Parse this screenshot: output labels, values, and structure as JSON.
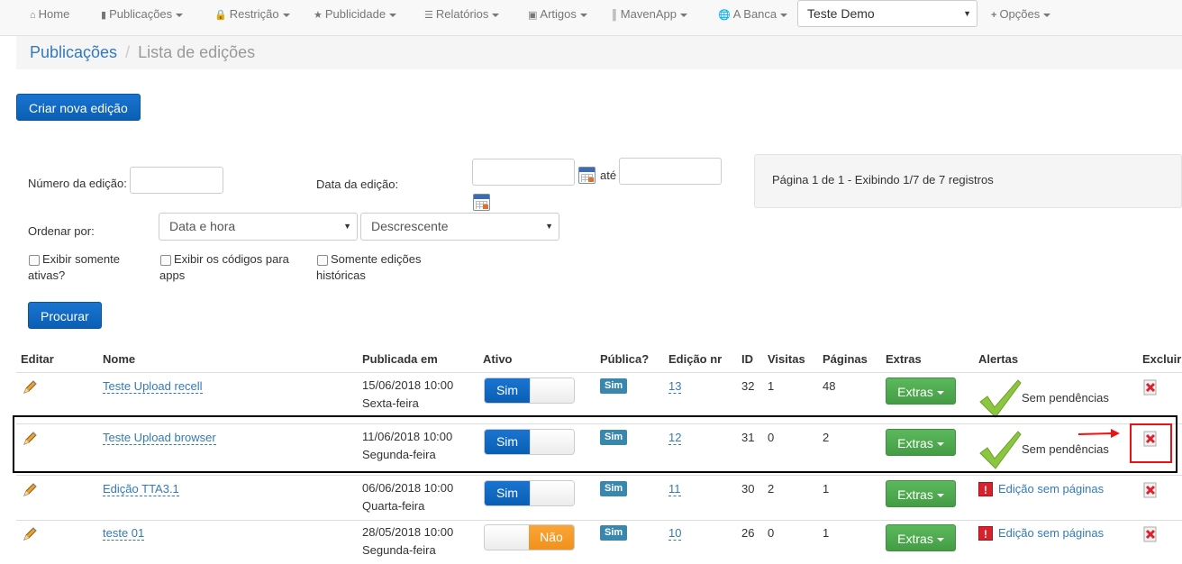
{
  "navbar": {
    "items": [
      {
        "label": "Home",
        "icon": "home-icon",
        "dropdown": false
      },
      {
        "label": "Publicações",
        "icon": "file-icon",
        "dropdown": true
      },
      {
        "label": "Restrição",
        "icon": "lock-icon",
        "dropdown": true
      },
      {
        "label": "Publicidade",
        "icon": "star-icon",
        "dropdown": true
      },
      {
        "label": "Relatórios",
        "icon": "list-icon",
        "dropdown": true
      },
      {
        "label": "Artigos",
        "icon": "book-icon",
        "dropdown": true
      },
      {
        "label": "MavenApp",
        "icon": "barcode-icon",
        "dropdown": true
      },
      {
        "label": "A Banca",
        "icon": "globe-icon",
        "dropdown": true
      }
    ],
    "account_select": "Teste Demo",
    "options": {
      "label": "Opções",
      "icon": "plus-icon"
    }
  },
  "breadcrumb": {
    "parent": "Publicações",
    "separator": "/",
    "current": "Lista de edições"
  },
  "create_button": "Criar nova edição",
  "filters": {
    "edition_number_label": "Número da edição:",
    "edition_date_label": "Data da edição:",
    "until_label": "até",
    "order_by_label": "Ordenar por:",
    "order_field": "Data e hora",
    "order_direction": "Descrescente",
    "checkboxes": [
      {
        "line1": "Exibir somente",
        "line2": "ativas?",
        "checked": false
      },
      {
        "line1": "Exibir os códigos para",
        "line2": "apps",
        "checked": false
      },
      {
        "line1": "Somente edições",
        "line2": "históricas",
        "checked": false
      }
    ],
    "search_button": "Procurar"
  },
  "pagination_info": "Página 1 de 1 - Exibindo 1/7 de 7 registros",
  "table": {
    "headers": [
      "Editar",
      "Nome",
      "Publicada em",
      "Ativo",
      "Pública?",
      "Edição nr",
      "ID",
      "Visitas",
      "Páginas",
      "Extras",
      "Alertas",
      "Excluir"
    ],
    "rows": [
      {
        "name": "Teste Upload recell",
        "date": "15/06/2018 10:00",
        "weekday": "Sexta-feira",
        "active": "Sim",
        "public": "Sim",
        "edition": "13",
        "id": "32",
        "visits": "1",
        "pages": "48",
        "extras": "Extras",
        "alert": "Sem pendências",
        "alert_type": "ok"
      },
      {
        "name": "Teste Upload browser",
        "date": "11/06/2018 10:00",
        "weekday": "Segunda-feira",
        "active": "Sim",
        "public": "Sim",
        "edition": "12",
        "id": "31",
        "visits": "0",
        "pages": "2",
        "extras": "Extras",
        "alert": "Sem pendências",
        "alert_type": "ok"
      },
      {
        "name": "Edição TTA3.1",
        "date": "06/06/2018 10:00",
        "weekday": "Quarta-feira",
        "active": "Sim",
        "public": "Sim",
        "edition": "11",
        "id": "30",
        "visits": "2",
        "pages": "1",
        "extras": "Extras",
        "alert": "Edição sem páginas",
        "alert_type": "warn"
      },
      {
        "name": "teste 01",
        "date": "28/05/2018 10:00",
        "weekday": "Segunda-feira",
        "active": "Não",
        "public": "Sim",
        "edition": "10",
        "id": "26",
        "visits": "0",
        "pages": "1",
        "extras": "Extras",
        "alert": "Edição sem páginas",
        "alert_type": "warn"
      }
    ]
  },
  "colors": {
    "primary": "#0a5fb4",
    "success": "#449d44",
    "link": "#337ab7",
    "badge": "#3a87ad",
    "toggle_off": "#f0911e",
    "highlight_red": "#e11111"
  }
}
